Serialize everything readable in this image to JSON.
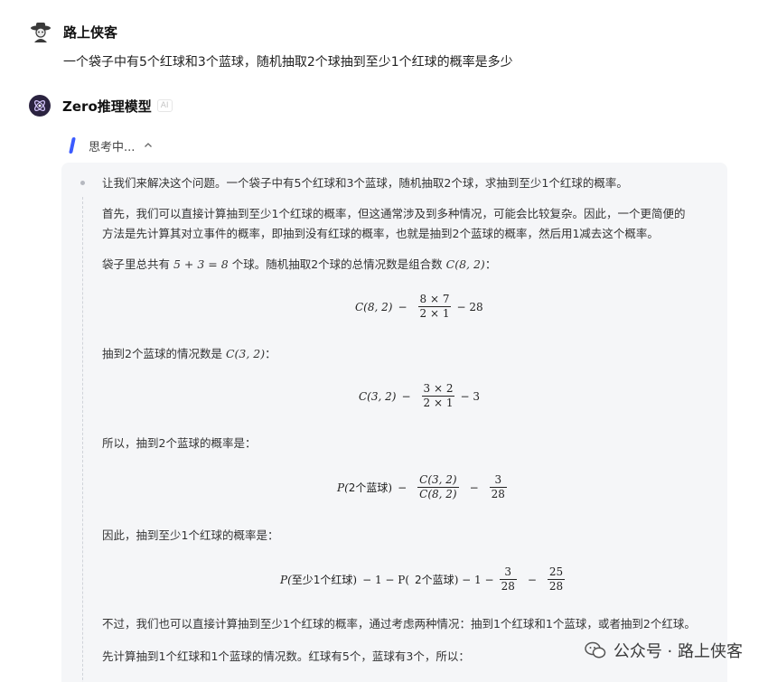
{
  "user": {
    "name": "路上侠客",
    "message": "一个袋子中有5个红球和3个蓝球，随机抽取2个球抽到至少1个红球的概率是多少"
  },
  "bot": {
    "name": "Zero推理模型",
    "badge": "AI"
  },
  "thinking": {
    "label": "思考中...",
    "paragraphs": {
      "p1": "让我们来解决这个问题。一个袋子中有5个红球和3个蓝球，随机抽取2个球，求抽到至少1个红球的概率。",
      "p2a": "首先，我们可以直接计算抽到至少1个红球的概率，但这通常涉及到多种情况，可能会比较复杂。因此，一个更简便的",
      "p2b": "方法是先计算其对立事件的概率，即抽到没有红球的概率，也就是抽到2个蓝球的概率，然后用1减去这个概率。",
      "p3_prefix": "袋子里总共有",
      "p3_math1": "5 + 3 = 8",
      "p3_middle": "个球。随机抽取2个球的总情况数是组合数",
      "p3_math2": "C(8, 2)",
      "p3_suffix": "：",
      "p4_prefix": "抽到2个蓝球的情况数是",
      "p4_math": "C(3, 2)",
      "p4_suffix": "：",
      "p5": "所以，抽到2个蓝球的概率是：",
      "p6": "因此，抽到至少1个红球的概率是：",
      "p7": "不过，我们也可以直接计算抽到至少1个红球的概率，通过考虑两种情况：抽到1个红球和1个蓝球，或者抽到2个红球。",
      "p8": "先计算抽到1个红球和1个蓝球的情况数。红球有5个，蓝球有3个，所以："
    },
    "eq1": {
      "lhs": "C(8, 2)",
      "eq": "−",
      "num": "8 × 7",
      "den": "2 × 1",
      "rhs": "− 28"
    },
    "eq2": {
      "lhs": "C(3, 2)",
      "eq": "−",
      "num": "3 × 2",
      "den": "2 × 1",
      "rhs": "− 3"
    },
    "eq3": {
      "lhs_p": "P(",
      "lhs_text": "2个蓝球",
      "lhs_close": ")",
      "eq": "−",
      "num": "C(3, 2)",
      "den": "C(8, 2)",
      "eq2": "−",
      "num2": "3",
      "den2": "28"
    },
    "eq4": {
      "lhs_p": "P(",
      "lhs_text": "至少1个红球",
      "lhs_close": ")",
      "mid": "− 1 − P(",
      "mid_text": "2个蓝球",
      "mid_close": ") − 1 −",
      "num": "3",
      "den": "28",
      "eq2": "−",
      "num2": "25",
      "den2": "28"
    }
  },
  "watermark": {
    "text": "公众号 · 路上侠客"
  },
  "colors": {
    "accent": "#3b5bff",
    "panel": "#f5f6f8"
  }
}
